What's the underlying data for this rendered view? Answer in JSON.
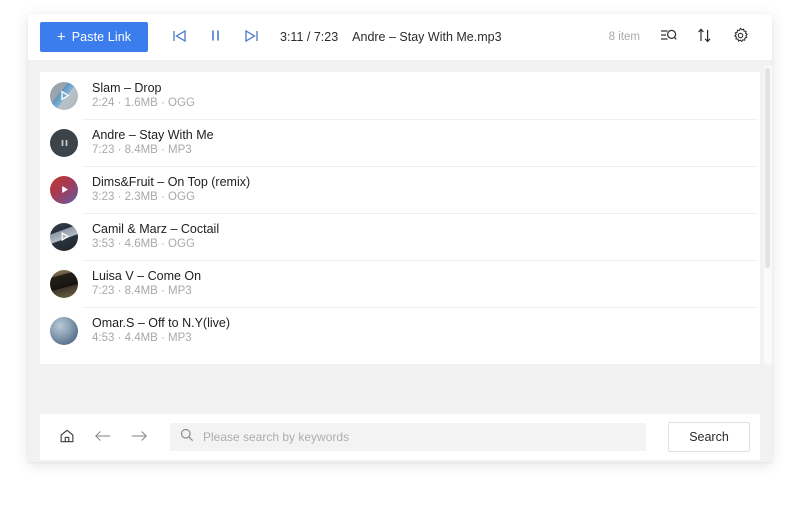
{
  "toolbar": {
    "paste_link_label": "Paste Link",
    "plus_glyph": "+",
    "controls": [
      {
        "name": "previous-button",
        "icon": "skip-previous-icon"
      },
      {
        "name": "pause-button",
        "icon": "pause-icon"
      },
      {
        "name": "next-button",
        "icon": "skip-next-icon"
      }
    ],
    "player_time": "3:11 / 7:23",
    "player_title": "Andre – Stay With Me.mp3",
    "item_count": "8 item",
    "right_icons": [
      {
        "name": "filter-search-icon",
        "label": "filter-search-icon"
      },
      {
        "name": "sort-icon",
        "label": "sort-icon"
      },
      {
        "name": "gear-icon",
        "label": "gear-icon"
      }
    ],
    "accent_color": "#3b7ded"
  },
  "list": {
    "tracks": [
      {
        "title": "Slam – Drop",
        "duration": "2:24",
        "size": "1.6MB",
        "format": "OGG",
        "sub": "2:24 · 1.6MB · OGG",
        "art": "art-slam",
        "badge": "play-outline-icon"
      },
      {
        "title": "Andre – Stay With Me",
        "duration": "7:23",
        "size": "8.4MB",
        "format": "MP3",
        "sub": "7:23 · 8.4MB · MP3",
        "art": "art-andre",
        "badge": "pause-icon"
      },
      {
        "title": "Dims&Fruit – On Top (remix)",
        "duration": "3:23",
        "size": "2.3MB",
        "format": "OGG",
        "sub": "3:23 · 2.3MB · OGG",
        "art": "art-dims",
        "badge": "play-solid-icon"
      },
      {
        "title": "Camil & Marz – Coctail",
        "duration": "3:53",
        "size": "4.6MB",
        "format": "OGG",
        "sub": "3:53 · 4.6MB · OGG",
        "art": "art-camil",
        "badge": "play-outline-icon"
      },
      {
        "title": "Luisa V – Come On",
        "duration": "7:23",
        "size": "8.4MB",
        "format": "MP3",
        "sub": "7:23 · 8.4MB · MP3",
        "art": "art-luisa",
        "badge": "none"
      },
      {
        "title": "Omar.S – Off to N.Y(live)",
        "duration": "4:53",
        "size": "4.4MB",
        "format": "MP3",
        "sub": "4:53 · 4.4MB · MP3",
        "art": "art-omar",
        "badge": "none"
      }
    ]
  },
  "bottom": {
    "nav": [
      {
        "name": "home-button",
        "icon": "home-icon"
      },
      {
        "name": "back-button",
        "icon": "arrow-left-icon"
      },
      {
        "name": "forward-button",
        "icon": "arrow-right-icon"
      }
    ],
    "search_placeholder": "Please search by keywords",
    "search_value": "",
    "search_button_label": "Search"
  }
}
